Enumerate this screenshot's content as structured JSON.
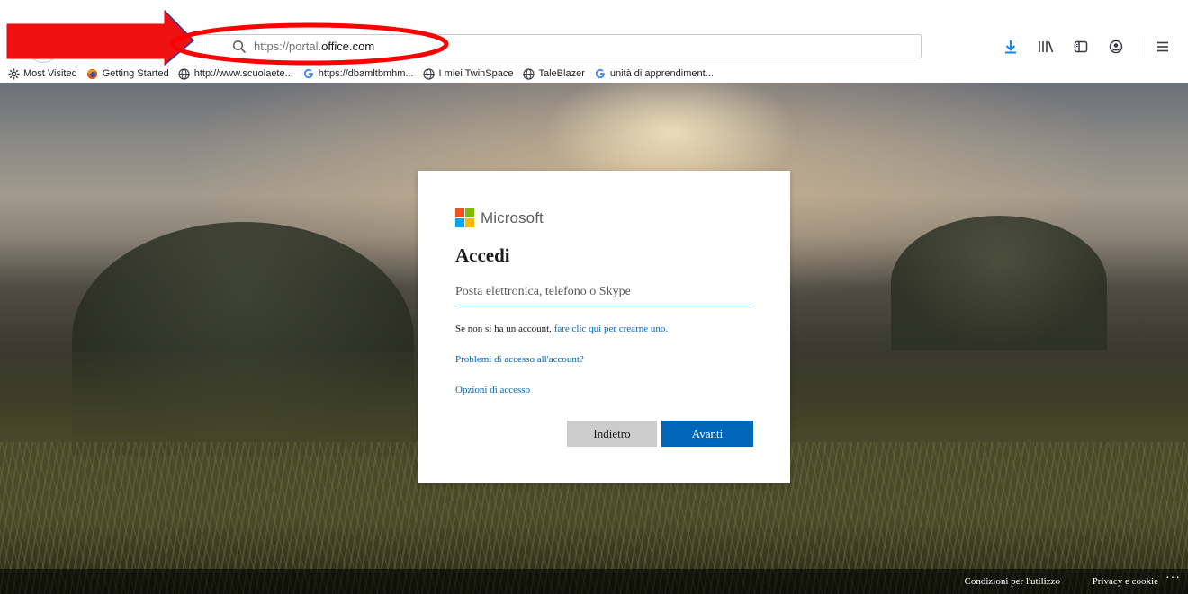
{
  "browser": {
    "url_dim_prefix": "https://portal.",
    "url_domain": "office.com",
    "toolbar_icons": [
      "download-icon",
      "library-icon",
      "sidebar-icon",
      "account-icon",
      "menu-icon"
    ],
    "bookmarks": [
      {
        "label": "Most Visited",
        "icon": "gear-icon"
      },
      {
        "label": "Getting Started",
        "icon": "firefox-icon"
      },
      {
        "label": "http://www.scuolaete...",
        "icon": "globe-icon"
      },
      {
        "label": "https://dbamltbmhm...",
        "icon": "google-icon"
      },
      {
        "label": "I miei TwinSpace",
        "icon": "globe-icon"
      },
      {
        "label": "TaleBlazer",
        "icon": "globe-icon"
      },
      {
        "label": "unità di apprendiment...",
        "icon": "google-icon"
      }
    ]
  },
  "signin": {
    "brand": "Microsoft",
    "title": "Accedi",
    "email_placeholder": "Posta elettronica, telefono o Skype",
    "email_value": "",
    "no_account_prefix": "Se non si ha un account, ",
    "no_account_link": "fare clic qui per crearne uno.",
    "problem_link": "Problemi di accesso all'account?",
    "options_link": "Opzioni di accesso",
    "back_button": "Indietro",
    "next_button": "Avanti"
  },
  "footer": {
    "terms": "Condizioni per l'utilizzo",
    "privacy": "Privacy e cookie",
    "more": "···"
  },
  "colors": {
    "accent_blue": "#0067b8",
    "annotation_red": "#ff0000",
    "ms_red": "#f25022",
    "ms_green": "#7fba00",
    "ms_blue": "#00a4ef",
    "ms_yellow": "#ffb900"
  }
}
